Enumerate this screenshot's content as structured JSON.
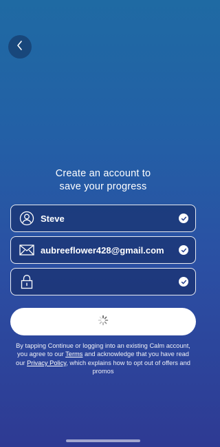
{
  "heading": {
    "line1": "Create an account to",
    "line2": "save your progress"
  },
  "fields": {
    "name": {
      "value": "Steve",
      "icon": "user-icon",
      "valid": true
    },
    "email": {
      "value": "aubreeflower428@gmail.com",
      "icon": "envelope-icon",
      "valid": true
    },
    "password": {
      "value": "",
      "icon": "lock-icon",
      "valid": true
    }
  },
  "continue_button": {
    "state": "loading",
    "icon": "spinner-icon"
  },
  "legal": {
    "part1": "By tapping Continue or logging into an existing Calm account, you agree to our ",
    "terms_link": "Terms",
    "part2": " and acknowledge that you have read our ",
    "privacy_link": "Privacy Policy",
    "part3": ", which explains how to opt out of offers and promos"
  },
  "colors": {
    "gradient_top": "#1f6aa3",
    "gradient_bottom": "#2e3a93",
    "field_border": "#ffffff",
    "button_bg": "#ffffff"
  }
}
